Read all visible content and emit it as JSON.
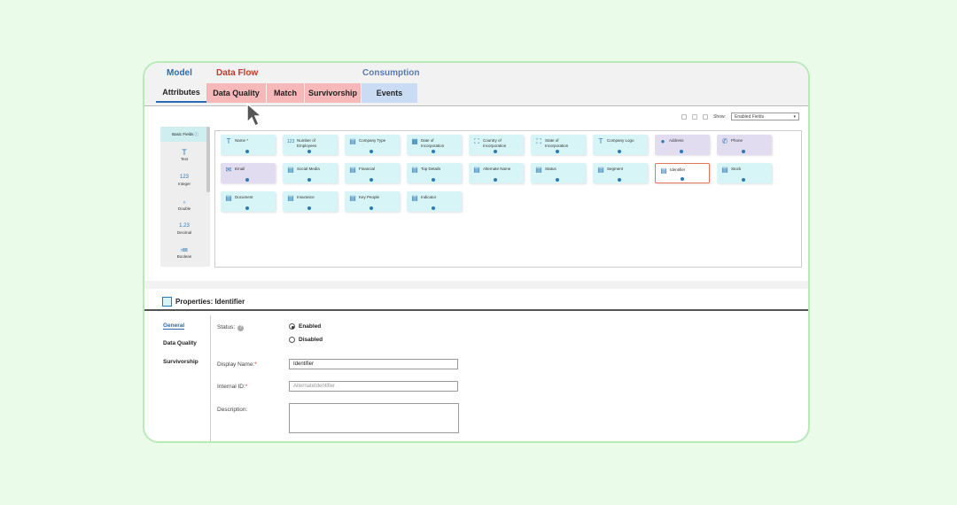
{
  "top_groups": {
    "model": "Model",
    "data_flow": "Data Flow",
    "consumption": "Consumption"
  },
  "tabs": [
    "Attributes",
    "Data Quality",
    "Match",
    "Survivorship",
    "Events"
  ],
  "toolbar": {
    "show_label": "Show:",
    "show_value": "Enabled Fields"
  },
  "palette": {
    "header": "Basic Fields",
    "items": [
      {
        "icon": "text-icon",
        "label": "Text"
      },
      {
        "icon": "integer-icon",
        "label": "Integer"
      },
      {
        "icon": "double-icon",
        "label": "Double"
      },
      {
        "icon": "decimal-icon",
        "label": "Decimal"
      },
      {
        "icon": "boolean-icon",
        "label": "Boolean"
      }
    ]
  },
  "fields": [
    {
      "label": "Name *",
      "icon": "T"
    },
    {
      "label": "Number of Employees",
      "icon": "123"
    },
    {
      "label": "Company Type",
      "icon": "▤"
    },
    {
      "label": "Date of Incorporation",
      "icon": "▦"
    },
    {
      "label": "Country of Incorporation",
      "icon": "⛶"
    },
    {
      "label": "State of Incorporation",
      "icon": "⛶"
    },
    {
      "label": "Company Logo",
      "icon": "T"
    },
    {
      "label": "Address",
      "icon": "●"
    },
    {
      "label": "Phone",
      "icon": "✆"
    },
    {
      "label": "Email",
      "icon": "✉"
    },
    {
      "label": "Social Media",
      "icon": "▤"
    },
    {
      "label": "Financial",
      "icon": "▤"
    },
    {
      "label": "Top Details",
      "icon": "▤"
    },
    {
      "label": "Alternate Name",
      "icon": "▤"
    },
    {
      "label": "Status",
      "icon": "▤"
    },
    {
      "label": "Segment",
      "icon": "▤"
    },
    {
      "label": "Identifier",
      "icon": "▤"
    },
    {
      "label": "Stock",
      "icon": "▤"
    },
    {
      "label": "Document",
      "icon": "▤"
    },
    {
      "label": "Insurance",
      "icon": "▤"
    },
    {
      "label": "Key People",
      "icon": "▤"
    },
    {
      "label": "Indicator",
      "icon": "▤"
    }
  ],
  "properties": {
    "title": "Properties: Identifier",
    "nav": [
      "General",
      "Data Quality",
      "Survivorship"
    ],
    "status_label": "Status:",
    "status_options": [
      "Enabled",
      "Disabled"
    ],
    "selected_status": "Enabled",
    "display_name_label": "Display Name:",
    "display_name_value": "Identifier",
    "internal_id_label": "Internal ID:",
    "internal_id_placeholder": "AlternateIdentifier",
    "description_label": "Description:",
    "required_mark": "*"
  },
  "colors": {
    "background": "#eafbea",
    "frame_border": "#b8eab6",
    "data_quality_tab": "#f6b8b8",
    "events_tab": "#c9dcf4",
    "card": "#d7f4f6",
    "card_purple": "#e2dcf0",
    "selected_border": "#e8755a",
    "accent": "#2b6cb0"
  }
}
